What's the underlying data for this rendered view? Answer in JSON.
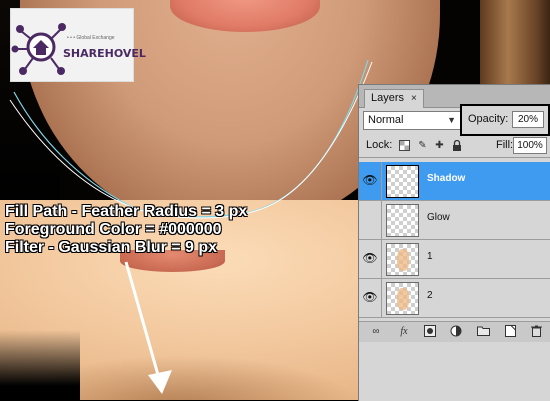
{
  "logo": {
    "text": "SHAREHOVEL",
    "tagline": "• • • Global Exchange",
    "icon": "house-network-icon"
  },
  "caption": {
    "line1": "Fill Path - Feather Radius = 3 px",
    "line2": "Foreground Color = #000000",
    "line3": "Filter - Gaussian Blur = 9 px"
  },
  "layers_panel": {
    "tab_label": "Layers",
    "tab_close": "×",
    "blend_mode": "Normal",
    "opacity_label": "Opacity:",
    "opacity_value": "20%",
    "lock_label": "Lock:",
    "fill_label": "Fill:",
    "fill_value": "100%",
    "layers": [
      {
        "name": "Shadow",
        "selected": true,
        "visible": true
      },
      {
        "name": "Glow",
        "selected": false,
        "visible": false
      },
      {
        "name": "1",
        "selected": false,
        "visible": true
      },
      {
        "name": "2",
        "selected": false,
        "visible": true
      }
    ],
    "bottom_icons": [
      "link-icon",
      "fx-icon",
      "mask-icon",
      "adjustment-icon",
      "folder-icon",
      "new-layer-icon",
      "trash-icon"
    ]
  },
  "colors": {
    "selected_row": "#3e9bf0",
    "panel_bg": "#d6d6d6",
    "path_line": "#7fd6e6"
  }
}
